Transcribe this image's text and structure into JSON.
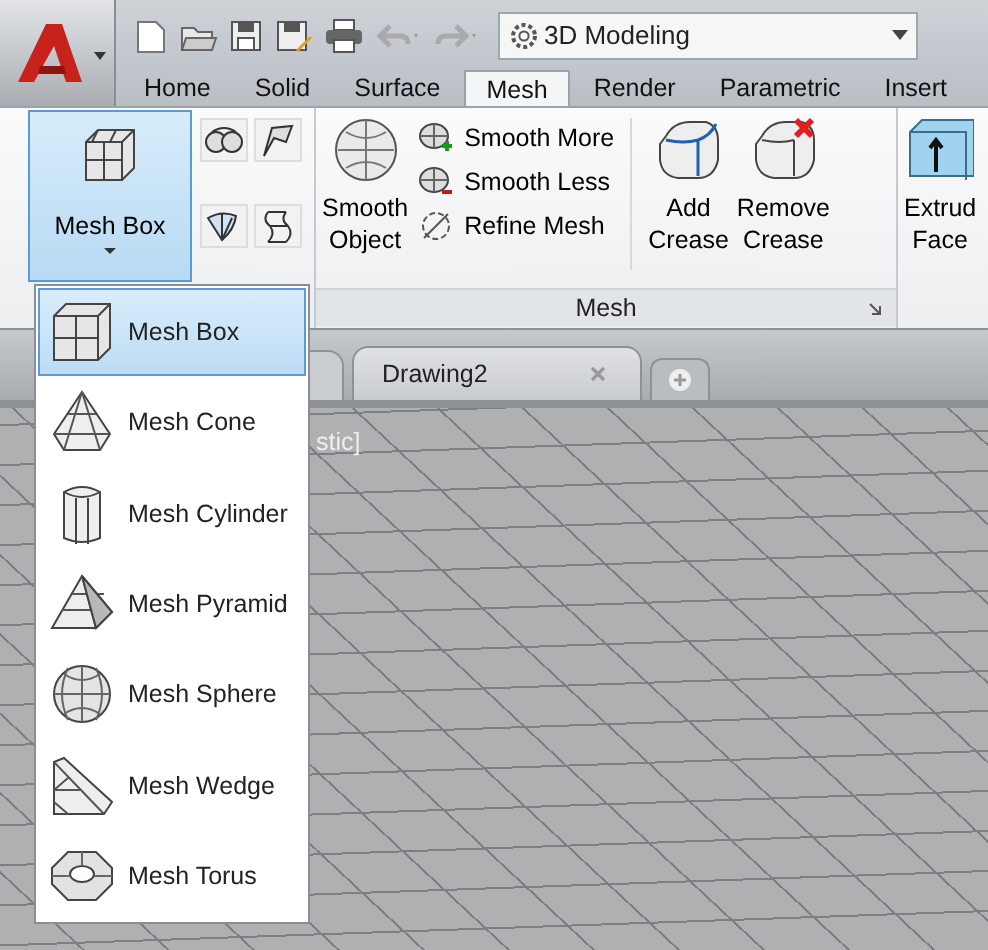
{
  "workspace": {
    "value": "3D Modeling"
  },
  "ribbon_tabs": [
    {
      "label": "Home",
      "selected": false
    },
    {
      "label": "Solid",
      "selected": false
    },
    {
      "label": "Surface",
      "selected": false
    },
    {
      "label": "Mesh",
      "selected": true
    },
    {
      "label": "Render",
      "selected": false
    },
    {
      "label": "Parametric",
      "selected": false
    },
    {
      "label": "Insert",
      "selected": false
    }
  ],
  "primitives_panel": {
    "split_button": {
      "label": "Mesh Box",
      "expanded": true
    }
  },
  "mesh_panel": {
    "title": "Mesh",
    "smooth_object": {
      "lines": [
        "Smooth",
        "Object"
      ]
    },
    "small_buttons": [
      {
        "label": "Smooth More",
        "kind": "more"
      },
      {
        "label": "Smooth Less",
        "kind": "less"
      },
      {
        "label": "Refine Mesh",
        "kind": "refine"
      }
    ],
    "crease_buttons": [
      {
        "lines": [
          "Add",
          "Crease"
        ],
        "kind": "add"
      },
      {
        "lines": [
          "Remove",
          "Crease"
        ],
        "kind": "remove"
      }
    ]
  },
  "edit_panel": {
    "button": {
      "lines": [
        "Extrud",
        "Face"
      ]
    }
  },
  "document_tabs": [
    {
      "label": "Drawing2",
      "selected": true
    }
  ],
  "viewport": {
    "label": "stic]"
  },
  "dropdown": [
    {
      "label": "Mesh Box",
      "kind": "box",
      "selected": true
    },
    {
      "label": "Mesh Cone",
      "kind": "cone",
      "selected": false
    },
    {
      "label": "Mesh Cylinder",
      "kind": "cylinder",
      "selected": false
    },
    {
      "label": "Mesh Pyramid",
      "kind": "pyramid",
      "selected": false
    },
    {
      "label": "Mesh Sphere",
      "kind": "sphere",
      "selected": false
    },
    {
      "label": "Mesh Wedge",
      "kind": "wedge",
      "selected": false
    },
    {
      "label": "Mesh Torus",
      "kind": "torus",
      "selected": false
    }
  ]
}
